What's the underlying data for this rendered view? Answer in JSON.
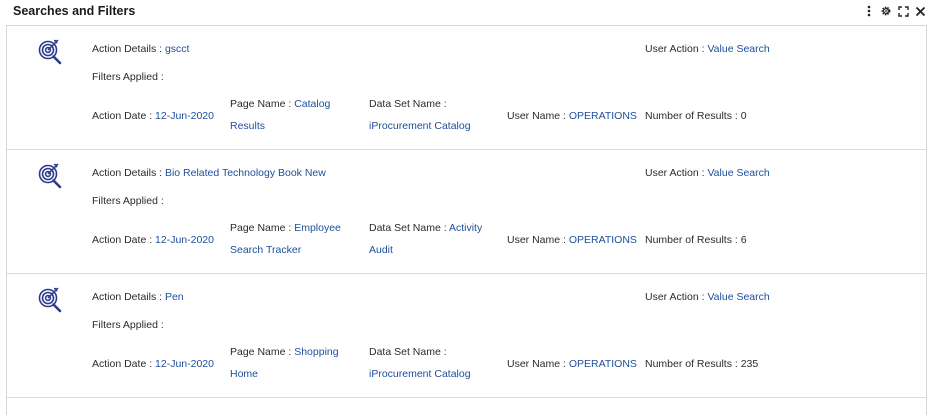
{
  "header": {
    "title": "Searches and Filters",
    "icons": [
      "more-vertical-icon",
      "gear-icon",
      "expand-icon",
      "close-icon"
    ]
  },
  "labels": {
    "action_details": "Action Details : ",
    "filters_applied": "Filters Applied :",
    "action_date": "Action Date : ",
    "page_name": "Page Name : ",
    "data_set_name": "Data Set Name : ",
    "user_name": "User Name : ",
    "user_action": "User Action : ",
    "number_of_results": "Number of Results : "
  },
  "colors": {
    "link": "#1e4f9c",
    "icon": "#2c3a8a"
  },
  "records": [
    {
      "icon": "target-search-icon",
      "action_details": "gscct",
      "user_action": "Value Search",
      "action_date": "12-Jun-2020",
      "page_name": "Catalog Results",
      "data_set_name": "iProcurement Catalog",
      "user_name": "OPERATIONS",
      "number_of_results": "0"
    },
    {
      "icon": "target-search-icon",
      "action_details": "Bio Related Technology Book New",
      "user_action": "Value Search",
      "action_date": "12-Jun-2020",
      "page_name": "Employee Search Tracker",
      "data_set_name": "Activity Audit",
      "user_name": "OPERATIONS",
      "number_of_results": "6"
    },
    {
      "icon": "target-search-icon",
      "action_details": "Pen",
      "user_action": "Value Search",
      "action_date": "12-Jun-2020",
      "page_name": "Shopping Home",
      "data_set_name": "iProcurement Catalog",
      "user_name": "OPERATIONS",
      "number_of_results": "235"
    }
  ]
}
